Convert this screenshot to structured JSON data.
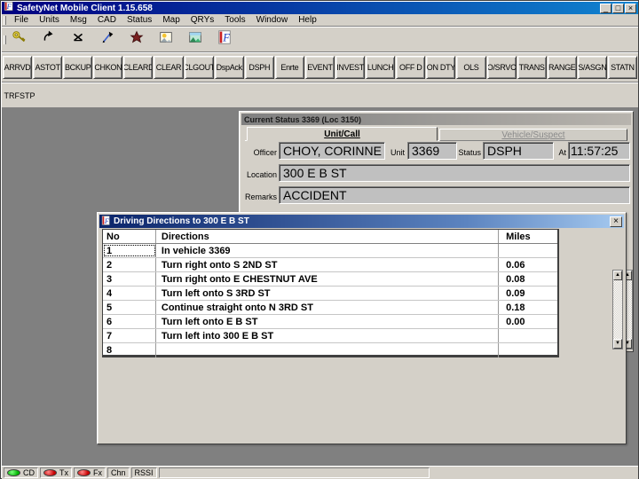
{
  "window": {
    "title": "SafetyNet Mobile Client 1.15.658",
    "controls": {
      "minimize": "_",
      "maximize": "□",
      "close": "×"
    }
  },
  "menu": {
    "items": [
      {
        "label": "File"
      },
      {
        "label": "Units"
      },
      {
        "label": "Msg"
      },
      {
        "label": "CAD"
      },
      {
        "label": "Status"
      },
      {
        "label": "Map"
      },
      {
        "label": "QRYs"
      },
      {
        "label": "Tools"
      },
      {
        "label": "Window"
      },
      {
        "label": "Help"
      }
    ]
  },
  "toolbar": {
    "icons": [
      "key-icon",
      "undo-arrow-icon",
      "delete-x-icon",
      "send-pen-icon",
      "badge-icon",
      "map-day-icon",
      "map-terrain-icon",
      "safetynet-logo-icon"
    ]
  },
  "status_buttons": {
    "row1": [
      "ARRVD",
      "ASTOT",
      "BCKUP",
      "CHKON",
      "CLEARD",
      "CLEAR",
      "CLGOUT",
      "DspAck",
      "DSPH",
      "Enrte",
      "EVENT",
      "INVEST",
      "LUNCH",
      "OFF D",
      "ON DTY",
      "OLS",
      "O/SRVC",
      "TRANS",
      "RANGE",
      "S/ASGN",
      "STATN"
    ],
    "row2": [
      "TRFSTP"
    ]
  },
  "status_panel": {
    "title": "Current Status 3369 (Loc 3150)",
    "tabs": [
      {
        "label": "Unit/Call",
        "active": true
      },
      {
        "label": "Vehicle/Suspect",
        "active": false
      }
    ],
    "officer_label": "Officer",
    "officer": "CHOY, CORINNE",
    "unit_label": "Unit",
    "unit": "3369",
    "status_label": "Status",
    "status": "DSPH",
    "at_label": "At",
    "time": "11:57:25",
    "location_label": "Location",
    "location": "300 E B ST",
    "remarks_label": "Remarks",
    "remarks": "ACCIDENT"
  },
  "directions_dialog": {
    "title": "Driving Directions to 300 E B ST",
    "close_glyph": "×",
    "columns": {
      "no": "No",
      "directions": "Directions",
      "miles": "Miles"
    },
    "rows": [
      {
        "no": "1",
        "directions": "In vehicle 3369",
        "miles": ""
      },
      {
        "no": "2",
        "directions": "Turn right onto S 2ND ST",
        "miles": "0.06"
      },
      {
        "no": "3",
        "directions": "Turn right onto E CHESTNUT AVE",
        "miles": "0.08"
      },
      {
        "no": "4",
        "directions": "Turn left onto S 3RD ST",
        "miles": "0.09"
      },
      {
        "no": "5",
        "directions": "Continue straight onto N 3RD ST",
        "miles": "0.18"
      },
      {
        "no": "6",
        "directions": "Turn left onto E B ST",
        "miles": "0.00"
      },
      {
        "no": "7",
        "directions": "Turn left into 300 E B ST",
        "miles": ""
      },
      {
        "no": "8",
        "directions": "",
        "miles": ""
      }
    ]
  },
  "statusbar": {
    "items": [
      {
        "led": "green",
        "label": "CD"
      },
      {
        "led": "red",
        "label": "Tx"
      },
      {
        "led": "red",
        "label": "Fx"
      },
      {
        "led": "",
        "label": "Chn"
      },
      {
        "led": "",
        "label": "RSSI"
      }
    ]
  },
  "colors": {
    "chrome": "#d4d0c8",
    "desktop": "#808080",
    "titlebar_active_start": "#000080",
    "titlebar_active_end": "#1084d0",
    "dialog_titlebar_start": "#0a246a",
    "dialog_titlebar_end": "#a6caf0",
    "titlebar_inactive_start": "#808080",
    "titlebar_inactive_end": "#b8b4ae",
    "field_bg": "#c0c0c0",
    "table_bg": "#ffffff",
    "led_green": "#00b400",
    "led_red": "#c80000"
  }
}
